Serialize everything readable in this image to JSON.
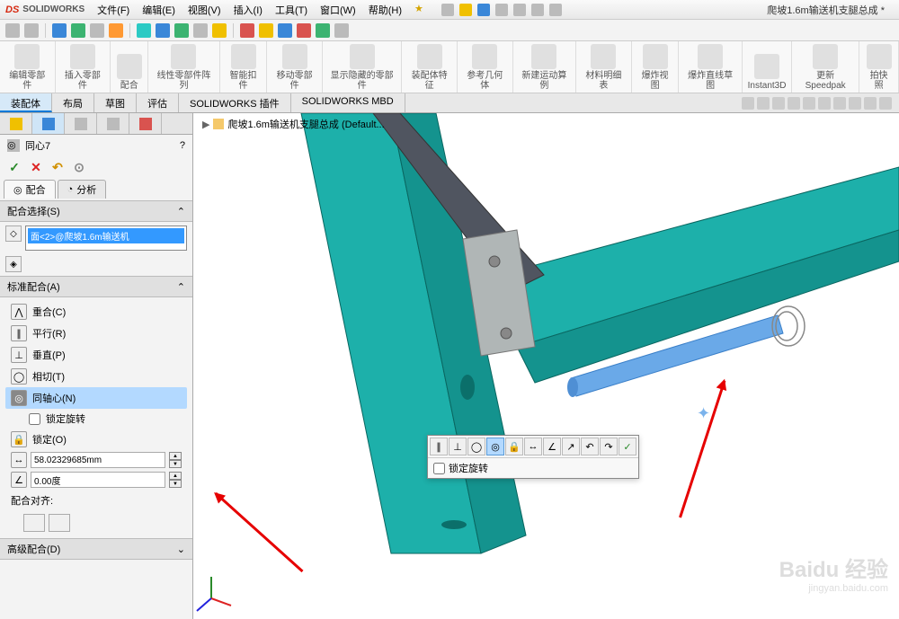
{
  "app": {
    "logo": "DS",
    "logo_text": "SOLIDWORKS",
    "doc_title": "爬坡1.6m输送机支腿总成 *"
  },
  "menu": {
    "file": "文件(F)",
    "edit": "编辑(E)",
    "view": "视图(V)",
    "insert": "插入(I)",
    "tools": "工具(T)",
    "window": "窗口(W)",
    "help": "帮助(H)"
  },
  "ribbon": {
    "g0": "编辑零部件",
    "g1": "插入零部件",
    "g2": "配合",
    "g3": "线性零部件阵列",
    "g4": "智能扣件",
    "g5": "移动零部件",
    "g6": "显示隐藏的零部件",
    "g7": "装配体特征",
    "g8": "参考几何体",
    "g9": "新建运动算例",
    "g10": "材料明细表",
    "g11": "爆炸视图",
    "g12": "爆炸直线草图",
    "g13": "Instant3D",
    "g14": "更新Speedpak",
    "g15": "拍快照"
  },
  "tabs": {
    "t0": "装配体",
    "t1": "布局",
    "t2": "草图",
    "t3": "评估",
    "t4": "SOLIDWORKS 插件",
    "t5": "SOLIDWORKS MBD"
  },
  "panel": {
    "title": "同心7",
    "sub_mate": "配合",
    "sub_analysis": "分析",
    "sec_select": "配合选择(S)",
    "sel_item": "面<2>@爬坡1.6m输送机",
    "sec_standard": "标准配合(A)",
    "m_coincident": "重合(C)",
    "m_parallel": "平行(R)",
    "m_perpendicular": "垂直(P)",
    "m_tangent": "相切(T)",
    "m_concentric": "同轴心(N)",
    "lock_rotation": "锁定旋转",
    "m_lock": "锁定(O)",
    "dist_value": "58.02329685mm",
    "angle_value": "0.00度",
    "align_label": "配合对齐:",
    "sec_advanced": "高级配合(D)"
  },
  "breadcrumb": {
    "name": "爬坡1.6m输送机支腿总成  (Default..."
  },
  "ctx": {
    "lock_rotation": "锁定旋转"
  },
  "watermark": {
    "brand": "Baidu 经验",
    "url": "jingyan.baidu.com"
  }
}
